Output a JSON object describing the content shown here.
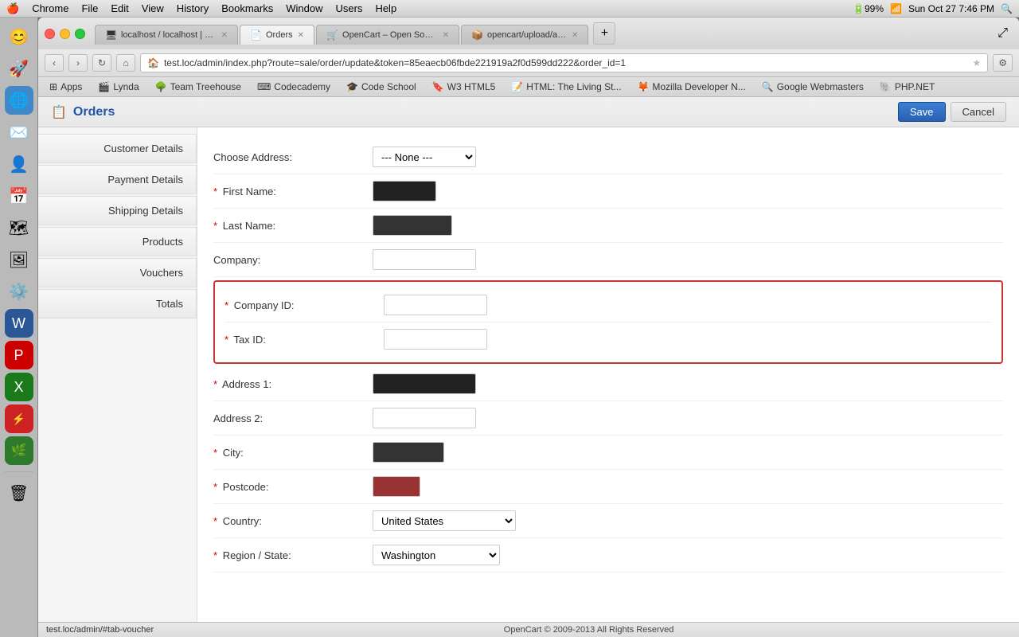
{
  "macmenubar": {
    "apple": "🍎",
    "menu_items": [
      "Chrome",
      "File",
      "Edit",
      "View",
      "History",
      "Bookmarks",
      "Window",
      "Users",
      "Help"
    ],
    "right": "Sun Oct 27  7:46 PM"
  },
  "browser": {
    "tabs": [
      {
        "id": "tab1",
        "label": "localhost / localhost | php ...",
        "favicon": "🖥",
        "active": false,
        "closeable": true
      },
      {
        "id": "tab2",
        "label": "Orders",
        "favicon": "📄",
        "active": true,
        "closeable": true
      },
      {
        "id": "tab3",
        "label": "OpenCart – Open Source S...",
        "favicon": "🛒",
        "active": false,
        "closeable": true
      },
      {
        "id": "tab4",
        "label": "opencart/upload/admin/v...",
        "favicon": "📦",
        "active": false,
        "closeable": true
      }
    ],
    "address": "test.loc/admin/index.php?route=sale/order/update&token=85eaecb06fbde221919a2f0d599dd222&order_id=1",
    "bookmarks": [
      {
        "label": "Apps",
        "favicon": "⊞"
      },
      {
        "label": "Lynda",
        "favicon": "🎬"
      },
      {
        "label": "Team Treehouse",
        "favicon": "🌳"
      },
      {
        "label": "Codecademy",
        "favicon": "⌨"
      },
      {
        "label": "Code School",
        "favicon": "🎓"
      },
      {
        "label": "W3 HTML5",
        "favicon": "🔖"
      },
      {
        "label": "HTML: The Living St...",
        "favicon": "📝"
      },
      {
        "label": "Mozilla Developer N...",
        "favicon": "🦊"
      },
      {
        "label": "Google Webmasters",
        "favicon": "🔍"
      },
      {
        "label": "PHP.NET",
        "favicon": "🐘"
      }
    ]
  },
  "page": {
    "title": "Orders",
    "title_icon": "📋",
    "save_button": "Save",
    "cancel_button": "Cancel"
  },
  "sidebar_tabs": [
    {
      "id": "customer-details",
      "label": "Customer Details"
    },
    {
      "id": "payment-details",
      "label": "Payment Details"
    },
    {
      "id": "shipping-details",
      "label": "Shipping Details"
    },
    {
      "id": "products",
      "label": "Products"
    },
    {
      "id": "vouchers",
      "label": "Vouchers"
    },
    {
      "id": "totals",
      "label": "Totals"
    }
  ],
  "form": {
    "choose_address_label": "Choose Address:",
    "choose_address_value": "--- None ---",
    "first_name_label": "First Name:",
    "first_name_required": true,
    "first_name_placeholder": "",
    "last_name_label": "Last Name:",
    "last_name_required": true,
    "company_label": "Company:",
    "company_id_label": "Company ID:",
    "company_id_required": true,
    "tax_id_label": "Tax ID:",
    "tax_id_required": true,
    "address1_label": "Address 1:",
    "address1_required": true,
    "address2_label": "Address 2:",
    "city_label": "City:",
    "city_required": true,
    "postcode_label": "Postcode:",
    "postcode_required": true,
    "country_label": "Country:",
    "country_required": true,
    "country_value": "United States",
    "region_label": "Region / State:",
    "region_required": true,
    "region_value": "Washington"
  },
  "status_bar": {
    "url": "test.loc/admin/#tab-voucher",
    "footer_text": "OpenCart © 2009-2013 All Rights Reserved"
  }
}
